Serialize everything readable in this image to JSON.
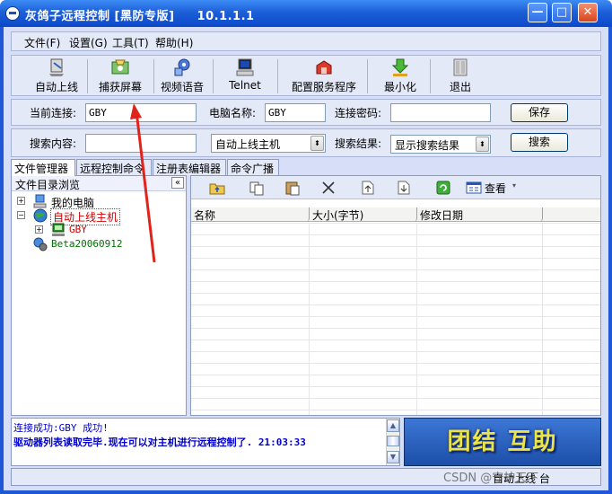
{
  "title": "灰鸽子远程控制 [黑防专版]     10.1.1.1",
  "window_buttons": {
    "minimize": "—",
    "maximize": "□",
    "close": "✕"
  },
  "menu": [
    "文件(F)",
    "设置(G)",
    "工具(T)",
    "帮助(H)"
  ],
  "toolbar": [
    {
      "label": "自动上线",
      "icon": "auto-online-icon"
    },
    {
      "label": "捕获屏幕",
      "icon": "capture-screen-icon"
    },
    {
      "label": "视频语音",
      "icon": "video-voice-icon"
    },
    {
      "label": "Telnet",
      "icon": "telnet-icon"
    },
    {
      "label": "配置服务程序",
      "icon": "configure-server-icon"
    },
    {
      "label": "最小化",
      "icon": "minimize-icon"
    },
    {
      "label": "退出",
      "icon": "exit-icon"
    }
  ],
  "connection": {
    "current_label": "当前连接:",
    "current_value": "GBY",
    "computer_label": "电脑名称:",
    "computer_value": "GBY",
    "password_label": "连接密码:",
    "password_value": "",
    "save_label": "保存"
  },
  "search": {
    "content_label": "搜索内容:",
    "content_value": "",
    "scope_value": "自动上线主机",
    "result_label": "搜索结果:",
    "result_value": "显示搜索结果",
    "search_label": "搜索"
  },
  "tabs": [
    "文件管理器",
    "远程控制命令",
    "注册表编辑器",
    "命令广播"
  ],
  "tree": {
    "header": "文件目录浏览",
    "collapse": "«",
    "nodes": [
      "我的电脑",
      "自动上线主机",
      "GBY",
      "Beta20060912"
    ]
  },
  "file_toolbar": {
    "view_label": "查看"
  },
  "file_columns": [
    "名称",
    "大小(字节)",
    "修改日期"
  ],
  "log": [
    "连接成功:GBY 成功!",
    "驱动器列表读取完毕.现在可以对主机进行远程控制了. 21:03:33"
  ],
  "banner": "团结 互助",
  "status": "自动上线 台",
  "watermark": "CSDN @守护天下",
  "colors": {
    "titlebar": "#1c5fd8",
    "log_text": "#0000cc",
    "tree_red": "#cc0000",
    "tree_green": "#007000",
    "banner_text": "#e8e44a",
    "arrow": "#e0231c"
  }
}
